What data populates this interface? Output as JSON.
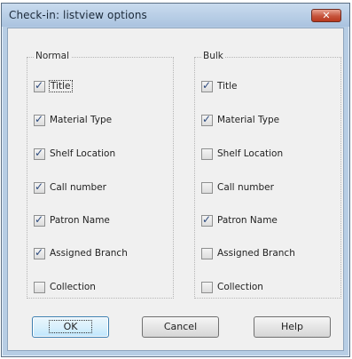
{
  "window": {
    "title": "Check-in: listview options",
    "close_glyph": "✕"
  },
  "groups": [
    {
      "title": "Normal",
      "items": [
        {
          "label": "Title",
          "checked": true,
          "focused": true
        },
        {
          "label": "Material Type",
          "checked": true
        },
        {
          "label": "Shelf Location",
          "checked": true
        },
        {
          "label": "Call number",
          "checked": true
        },
        {
          "label": "Patron Name",
          "checked": true
        },
        {
          "label": "Assigned Branch",
          "checked": true
        },
        {
          "label": "Collection",
          "checked": false
        }
      ]
    },
    {
      "title": "Bulk",
      "items": [
        {
          "label": "Title",
          "checked": true
        },
        {
          "label": "Material Type",
          "checked": true
        },
        {
          "label": "Shelf Location",
          "checked": false
        },
        {
          "label": "Call number",
          "checked": false
        },
        {
          "label": "Patron Name",
          "checked": true
        },
        {
          "label": "Assigned Branch",
          "checked": false
        },
        {
          "label": "Collection",
          "checked": false
        }
      ]
    }
  ],
  "buttons": {
    "ok": "OK",
    "cancel": "Cancel",
    "help": "Help"
  },
  "colors": {
    "titlebar": "#b7cde4",
    "dialog_bg": "#f0f0f0",
    "close_button": "#c6543c",
    "default_button_border": "#3c7fb1"
  }
}
